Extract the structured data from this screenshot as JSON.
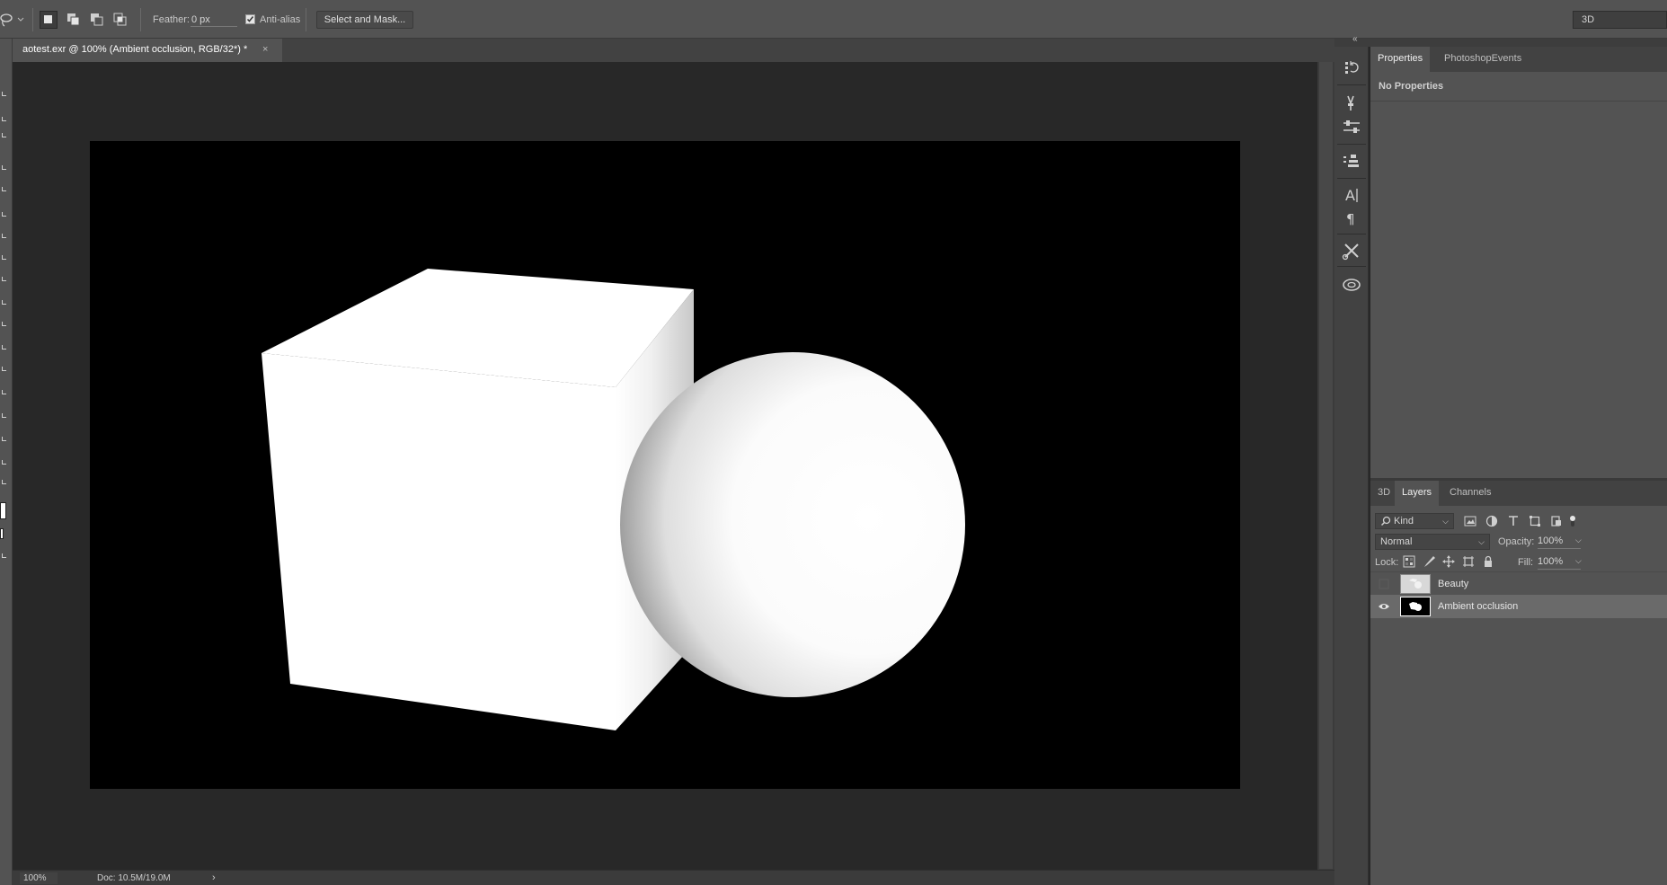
{
  "options_bar": {
    "feather_label": "Feather:",
    "feather_value": "0 px",
    "antialias_label": "Anti-alias",
    "antialias_checked": true,
    "select_mask_label": "Select and Mask...",
    "workspace_value": "3D"
  },
  "document": {
    "tab_title": "aotest.exr @ 100% (Ambient occlusion, RGB/32*) *",
    "close_glyph": "×"
  },
  "status_bar": {
    "zoom": "100%",
    "doc_size": "Doc: 10.5M/19.0M",
    "arrow": "›"
  },
  "properties_panel": {
    "tabs": [
      "Properties",
      "PhotoshopEvents"
    ],
    "active_tab": "Properties",
    "empty_message": "No Properties"
  },
  "layers_panel": {
    "tabs": [
      "3D",
      "Layers",
      "Channels"
    ],
    "active_tab": "Layers",
    "filter_kind": "Kind",
    "blend_mode": "Normal",
    "opacity_label": "Opacity:",
    "opacity_value": "100%",
    "lock_label": "Lock:",
    "fill_label": "Fill:",
    "fill_value": "100%",
    "layers": [
      {
        "name": "Beauty",
        "visible": false,
        "selected": false
      },
      {
        "name": "Ambient occlusion",
        "visible": true,
        "selected": true
      }
    ]
  },
  "icons": {
    "panel_collapse": "«",
    "dock": [
      "history-icon",
      "brush-icon",
      "adjustment-sliders-icon",
      "clone-source-icon",
      "character-icon",
      "paragraph-icon",
      "tool-presets-icon",
      "libraries-icon"
    ]
  },
  "colors": {
    "ui_dark": "#282828",
    "ui_mid": "#535353",
    "ui_panel": "#424242",
    "selected_layer": "#6a6a6a",
    "image_background": "#000000",
    "foreground_color": "#ffffff"
  }
}
